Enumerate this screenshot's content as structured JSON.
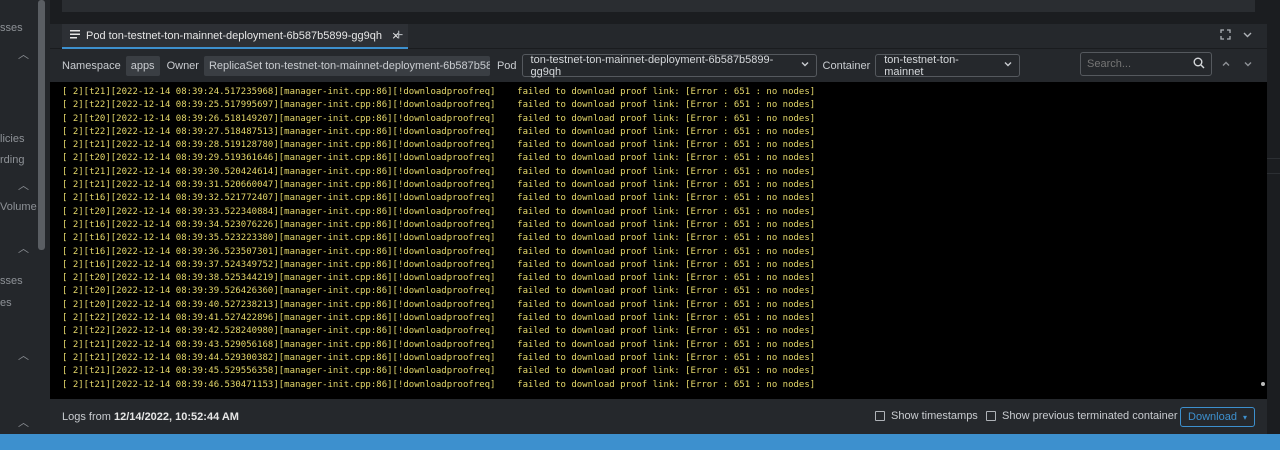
{
  "sidebar": {
    "fragments": [
      "sses",
      "licies",
      "rding",
      "Volume",
      "sses",
      "es"
    ]
  },
  "tab": {
    "icon": "list-icon",
    "label": "Pod ton-testnet-ton-mainnet-deployment-6b587b5899-gg9qh",
    "close": "×",
    "add": "+"
  },
  "controls": {
    "namespace_label": "Namespace",
    "namespace_value": "apps",
    "owner_label": "Owner",
    "owner_value": "ReplicaSet ton-testnet-ton-mainnet-deployment-6b587b5899",
    "pod_label": "Pod",
    "pod_value": "ton-testnet-ton-mainnet-deployment-6b587b5899-gg9qh",
    "container_label": "Container",
    "container_value": "ton-testnet-ton-mainnet",
    "search_placeholder": "Search..."
  },
  "logs": [
    "[ 2][t21][2022-12-14 08:39:24.517235968][manager-init.cpp:86][!downloadproofreq]    failed to download proof link: [Error : 651 : no nodes]",
    "[ 2][t22][2022-12-14 08:39:25.517995697][manager-init.cpp:86][!downloadproofreq]    failed to download proof link: [Error : 651 : no nodes]",
    "[ 2][t20][2022-12-14 08:39:26.518149207][manager-init.cpp:86][!downloadproofreq]    failed to download proof link: [Error : 651 : no nodes]",
    "[ 2][t22][2022-12-14 08:39:27.518487513][manager-init.cpp:86][!downloadproofreq]    failed to download proof link: [Error : 651 : no nodes]",
    "[ 2][t21][2022-12-14 08:39:28.519128780][manager-init.cpp:86][!downloadproofreq]    failed to download proof link: [Error : 651 : no nodes]",
    "[ 2][t20][2022-12-14 08:39:29.519361646][manager-init.cpp:86][!downloadproofreq]    failed to download proof link: [Error : 651 : no nodes]",
    "[ 2][t21][2022-12-14 08:39:30.520424614][manager-init.cpp:86][!downloadproofreq]    failed to download proof link: [Error : 651 : no nodes]",
    "[ 2][t21][2022-12-14 08:39:31.520660047][manager-init.cpp:86][!downloadproofreq]    failed to download proof link: [Error : 651 : no nodes]",
    "[ 2][t16][2022-12-14 08:39:32.521772407][manager-init.cpp:86][!downloadproofreq]    failed to download proof link: [Error : 651 : no nodes]",
    "[ 2][t20][2022-12-14 08:39:33.522340884][manager-init.cpp:86][!downloadproofreq]    failed to download proof link: [Error : 651 : no nodes]",
    "[ 2][t16][2022-12-14 08:39:34.523076226][manager-init.cpp:86][!downloadproofreq]    failed to download proof link: [Error : 651 : no nodes]",
    "[ 2][t16][2022-12-14 08:39:35.523223380][manager-init.cpp:86][!downloadproofreq]    failed to download proof link: [Error : 651 : no nodes]",
    "[ 2][t16][2022-12-14 08:39:36.523507301][manager-init.cpp:86][!downloadproofreq]    failed to download proof link: [Error : 651 : no nodes]",
    "[ 2][t16][2022-12-14 08:39:37.524349752][manager-init.cpp:86][!downloadproofreq]    failed to download proof link: [Error : 651 : no nodes]",
    "[ 2][t20][2022-12-14 08:39:38.525344219][manager-init.cpp:86][!downloadproofreq]    failed to download proof link: [Error : 651 : no nodes]",
    "[ 2][t20][2022-12-14 08:39:39.526426360][manager-init.cpp:86][!downloadproofreq]    failed to download proof link: [Error : 651 : no nodes]",
    "[ 2][t20][2022-12-14 08:39:40.527238213][manager-init.cpp:86][!downloadproofreq]    failed to download proof link: [Error : 651 : no nodes]",
    "[ 2][t22][2022-12-14 08:39:41.527422896][manager-init.cpp:86][!downloadproofreq]    failed to download proof link: [Error : 651 : no nodes]",
    "[ 2][t22][2022-12-14 08:39:42.528240980][manager-init.cpp:86][!downloadproofreq]    failed to download proof link: [Error : 651 : no nodes]",
    "[ 2][t21][2022-12-14 08:39:43.529056168][manager-init.cpp:86][!downloadproofreq]    failed to download proof link: [Error : 651 : no nodes]",
    "[ 2][t21][2022-12-14 08:39:44.529300382][manager-init.cpp:86][!downloadproofreq]    failed to download proof link: [Error : 651 : no nodes]",
    "[ 2][t21][2022-12-14 08:39:45.529556358][manager-init.cpp:86][!downloadproofreq]    failed to download proof link: [Error : 651 : no nodes]",
    "[ 2][t21][2022-12-14 08:39:46.530471153][manager-init.cpp:86][!downloadproofreq]    failed to download proof link: [Error : 651 : no nodes]"
  ],
  "footer": {
    "logs_from_label": "Logs from",
    "logs_from_value": "12/14/2022, 10:52:44 AM",
    "show_timestamps": "Show timestamps",
    "show_previous": "Show previous terminated container",
    "download": "Download"
  },
  "colors": {
    "accent": "#3d90ce",
    "log_text": "#e5d86a",
    "log_bg": "#000000",
    "panel_bg": "#25282c"
  }
}
